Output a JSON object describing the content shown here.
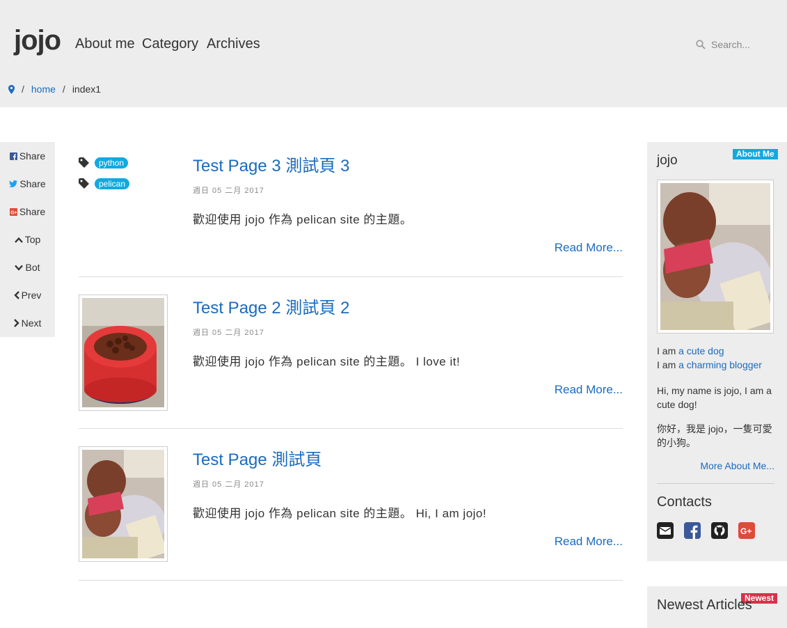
{
  "header": {
    "brand": "jojo",
    "nav": [
      "About me",
      "Category",
      "Archives"
    ],
    "search_placeholder": "Search..."
  },
  "breadcrumb": {
    "home": "home",
    "current": "index1",
    "sep": "/"
  },
  "share": {
    "facebook": "Share",
    "twitter": "Share",
    "google": "Share",
    "top": "Top",
    "bot": "Bot",
    "prev": "Prev",
    "next": "Next"
  },
  "posts": [
    {
      "title": "Test Page 3 測試頁 3",
      "date": "週日 05 二月 2017",
      "summary": "歡迎使用 jojo 作為 pelican site 的主題。",
      "read_more": "Read More...",
      "tags": [
        "python",
        "pelican"
      ]
    },
    {
      "title": "Test Page 2 測試頁 2",
      "date": "週日 05 二月 2017",
      "summary": "歡迎使用 jojo 作為 pelican site 的主題。 I love it!",
      "read_more": "Read More..."
    },
    {
      "title": "Test Page 測試頁",
      "date": "週日 05 二月 2017",
      "summary": "歡迎使用 jojo 作為 pelican site 的主題。 Hi, I am jojo!",
      "read_more": "Read More..."
    }
  ],
  "sidebar": {
    "name": "jojo",
    "badge": "About Me",
    "line1_prefix": "I am",
    "line1_link": "a cute dog",
    "line2_prefix": "I am",
    "line2_link": "a charming blogger",
    "bio_en": "Hi, my name is jojo, I am a cute dog!",
    "bio_zh": "你好，我是 jojo，一隻可愛的小狗。",
    "more": "More About Me...",
    "contacts_title": "Contacts",
    "newest_title": "Newest Articles",
    "newest_badge": "Newest"
  },
  "colors": {
    "link": "#1a6bbf",
    "tag": "#12a9e0",
    "badge_about": "#12a9e0",
    "badge_newest": "#d9314a",
    "panel": "#ededed"
  }
}
